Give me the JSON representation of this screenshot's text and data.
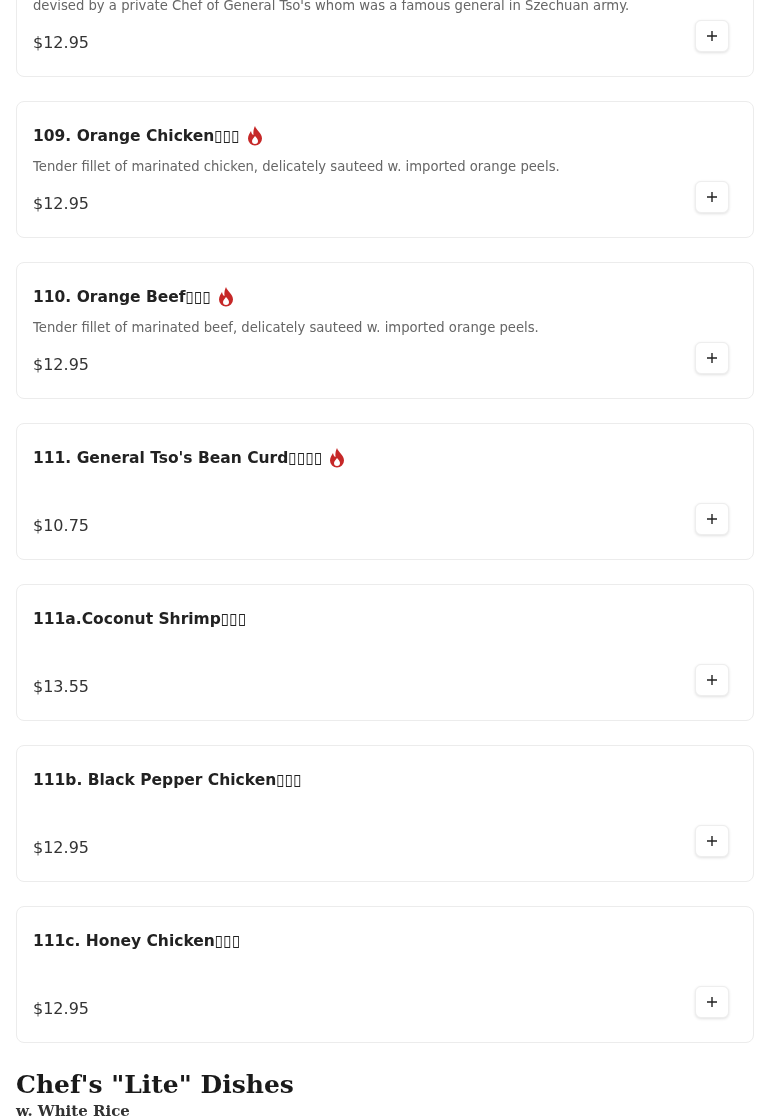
{
  "items": [
    {
      "description": "devised by a private Chef of General Tso's whom was a famous general in Szechuan army.",
      "price": "$12.95"
    },
    {
      "name": "109. Orange Chicken▯▯▯",
      "description": "Tender fillet of marinated chicken, delicately sauteed w. imported orange peels.",
      "price": "$12.95",
      "spicy": true
    },
    {
      "name": "110. Orange Beef▯▯▯",
      "description": "Tender fillet of marinated beef, delicately sauteed w. imported orange peels.",
      "price": "$12.95",
      "spicy": true
    },
    {
      "name": "111. General Tso's Bean Curd▯▯▯▯",
      "price": "$10.75",
      "spicy": true
    },
    {
      "name": "111a.Coconut Shrimp▯▯▯",
      "price": "$13.55"
    },
    {
      "name": "111b. Black Pepper Chicken▯▯▯",
      "price": "$12.95"
    },
    {
      "name": "111c. Honey Chicken▯▯▯",
      "price": "$12.95"
    }
  ],
  "section": {
    "title": "Chef's \"Lite\" Dishes",
    "subtitle": "w. White Rice"
  }
}
